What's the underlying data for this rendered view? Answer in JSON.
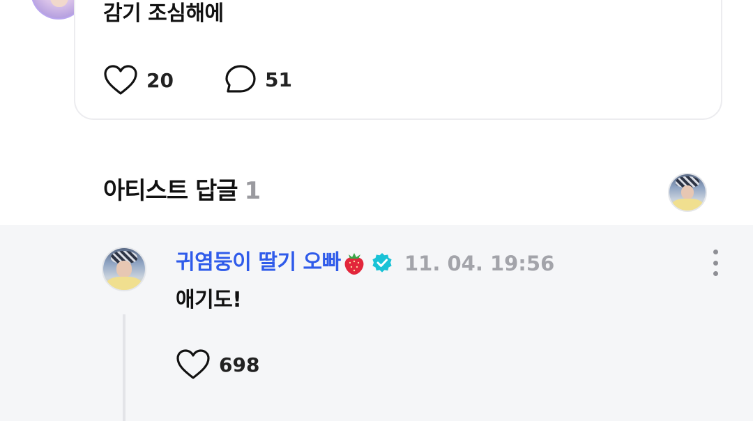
{
  "post": {
    "text": "감기 조심해에",
    "likes": "20",
    "comments": "51"
  },
  "section": {
    "title": "아티스트 답글",
    "count": "1"
  },
  "reply": {
    "author": "귀염둥이 딸기 오빠",
    "author_emoji": "strawberry-icon",
    "verified": true,
    "timestamp": "11. 04. 19:56",
    "text": "애기도!",
    "likes": "698"
  },
  "colors": {
    "author_name": "#2f5bea",
    "verified_badge": "#19c2d6",
    "timestamp": "#a3a4aa",
    "section_count": "#9a9a9f",
    "reply_background": "#f5f6f8"
  },
  "icons": {
    "like": "heart-outline-icon",
    "comment": "speech-bubble-icon",
    "more": "more-vertical-icon",
    "verified": "verified-badge-icon"
  }
}
